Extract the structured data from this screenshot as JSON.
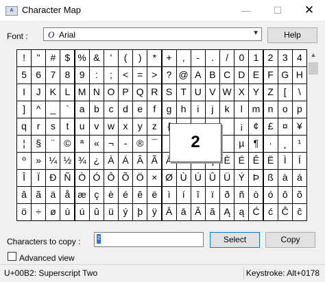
{
  "window": {
    "title": "Character Map",
    "minimize": "—",
    "maximize": "☐",
    "close": "✕",
    "icon": "charmap-app-icon"
  },
  "font": {
    "label": "Font :",
    "selected": "Arial",
    "type_icon": "O",
    "help_button": "Help"
  },
  "grid": {
    "rows": [
      [
        "!",
        "\"",
        "#",
        "$",
        "%",
        "&",
        "'",
        "(",
        ")",
        "*",
        "+",
        ",",
        "-",
        ".",
        "/",
        "0",
        "1",
        "2",
        "3",
        "4"
      ],
      [
        "5",
        "6",
        "7",
        "8",
        "9",
        ":",
        ";",
        "<",
        "=",
        ">",
        "?",
        "@",
        "A",
        "B",
        "C",
        "D",
        "E",
        "F",
        "G",
        "H"
      ],
      [
        "I",
        "J",
        "K",
        "L",
        "M",
        "N",
        "O",
        "P",
        "Q",
        "R",
        "S",
        "T",
        "U",
        "V",
        "W",
        "X",
        "Y",
        "Z",
        "[",
        "\\"
      ],
      [
        "]",
        "^",
        "_",
        "`",
        "a",
        "b",
        "c",
        "d",
        "e",
        "f",
        "g",
        "h",
        "i",
        "j",
        "k",
        "l",
        "m",
        "n",
        "o",
        "p"
      ],
      [
        "q",
        "r",
        "s",
        "t",
        "u",
        "v",
        "w",
        "x",
        "y",
        "z",
        "{",
        "",
        "",
        "",
        "",
        "¡",
        "¢",
        "£",
        "¤",
        "¥"
      ],
      [
        "¦",
        "§",
        "¨",
        "©",
        "ª",
        "«",
        "¬",
        "-",
        "®",
        "¯",
        "",
        "",
        "",
        "",
        "",
        "µ",
        "¶",
        "·",
        "¸",
        "¹"
      ],
      [
        "º",
        "»",
        "¼",
        "½",
        "¾",
        "¿",
        "À",
        "Á",
        "Â",
        "Ã",
        "Ä",
        "Å",
        "Æ",
        "Ç",
        "È",
        "É",
        "Ê",
        "Ë",
        "Ì",
        "Í"
      ],
      [
        "Î",
        "Ï",
        "Ð",
        "Ñ",
        "Ò",
        "Ó",
        "Ô",
        "Õ",
        "Ö",
        "×",
        "Ø",
        "Ù",
        "Ú",
        "Û",
        "Ü",
        "Ý",
        "Þ",
        "ß",
        "à",
        "á"
      ],
      [
        "â",
        "ã",
        "ä",
        "å",
        "æ",
        "ç",
        "è",
        "é",
        "ê",
        "ë",
        "ì",
        "í",
        "î",
        "ï",
        "ð",
        "ñ",
        "ò",
        "ó",
        "ô",
        "õ"
      ],
      [
        "ö",
        "÷",
        "ø",
        "ù",
        "ú",
        "û",
        "ü",
        "ý",
        "þ",
        "ÿ",
        "Ā",
        "ā",
        "Ă",
        "ă",
        "Ą",
        "ą",
        "Ć",
        "ć",
        "Ĉ",
        "ĉ"
      ]
    ],
    "zoom_char": "2",
    "scroll_up": "▲"
  },
  "copy": {
    "label": "Characters to copy :",
    "value": "²",
    "select_button": "Select",
    "copy_button": "Copy",
    "advanced_view": "Advanced view"
  },
  "status": {
    "left": "U+00B2: Superscript Two",
    "right": "Keystroke: Alt+0178"
  }
}
